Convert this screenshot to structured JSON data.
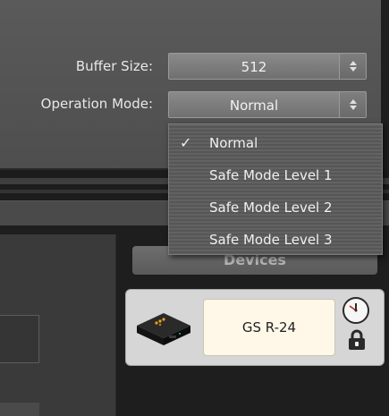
{
  "settings": {
    "buffer_size": {
      "label": "Buffer Size:",
      "value": "512"
    },
    "operation_mode": {
      "label": "Operation Mode:",
      "value": "Normal"
    }
  },
  "operation_mode_menu": {
    "items": [
      {
        "label": "Normal",
        "checked": true,
        "check_glyph": "✓"
      },
      {
        "label": "Safe Mode Level 1",
        "checked": false
      },
      {
        "label": "Safe Mode Level 2",
        "checked": false
      },
      {
        "label": "Safe Mode Level 3",
        "checked": false
      }
    ]
  },
  "devices": {
    "button_label": "Devices",
    "list": [
      {
        "name": "GS R-24",
        "icon": "audio-interface-device-icon",
        "status_icons": [
          "clock-icon",
          "lock-icon"
        ]
      }
    ]
  },
  "colors": {
    "panel": "#555555",
    "device_name_bg": "#fff8e8",
    "device_card_bg": "#d6d6d6",
    "device_accent": "#f0a020"
  }
}
